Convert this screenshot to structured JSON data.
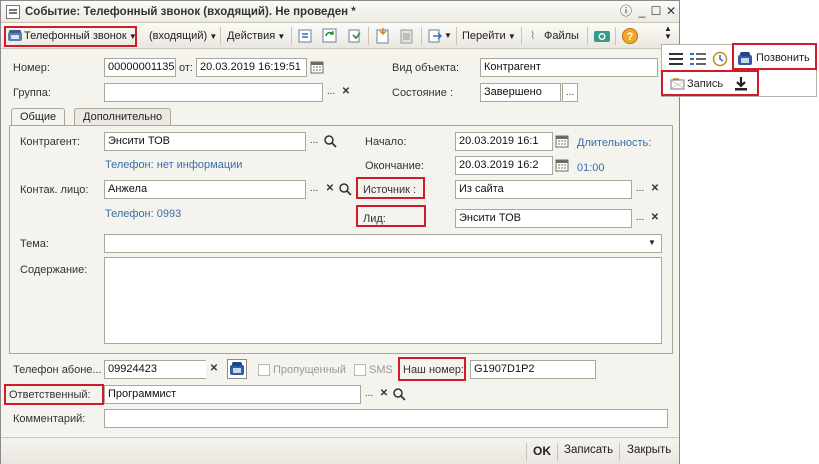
{
  "window": {
    "title": "Событие: Телефонный звонок (входящий). Не проведен *"
  },
  "toolbar": {
    "type_label": "Телефонный звонок",
    "direction_label": "(входящий)",
    "actions_label": "Действия",
    "goto_label": "Перейти",
    "files_label": "Файлы"
  },
  "form": {
    "number_label": "Номер:",
    "number_value": "00000001135",
    "from_label": "от:",
    "date_value": "20.03.2019 16:19:51",
    "object_type_label": "Вид объекта:",
    "object_type_value": "Контрагент",
    "group_label": "Группа:",
    "group_value": "",
    "state_label": "Состояние :",
    "state_value": "Завершено"
  },
  "tabs": [
    {
      "label": "Общие",
      "active": true
    },
    {
      "label": "Дополнительно",
      "active": false
    }
  ],
  "general": {
    "counterparty_label": "Контрагент:",
    "counterparty_value": "Энсити ТОВ",
    "phone_info": "Телефон: нет информации",
    "start_label": "Начало:",
    "start_value": "20.03.2019 16:1",
    "duration_label": "Длительность:",
    "end_label": "Окончание:",
    "end_value": "20.03.2019 16:2",
    "duration_value": "01:00",
    "contact_label": "Контак. лицо:",
    "contact_value": "Анжела",
    "contact_phone": "Телефон: 0993",
    "source_label": "Источник :",
    "source_value": "Из сайта",
    "lead_label": "Лид:",
    "lead_value": "Энсити ТОВ",
    "subject_label": "Тема:",
    "subject_value": "",
    "content_label": "Содержание:",
    "content_value": ""
  },
  "footer_fields": {
    "subscriber_phone_label": "Телефон абоне...",
    "subscriber_phone_value": "09924423",
    "missed_label": "Пропущенный",
    "sms_label": "SMS",
    "our_number_label": "Наш номер:",
    "our_number_value": "G1907D1P2",
    "responsible_label": "Ответственный:",
    "responsible_value": "Программист",
    "comment_label": "Комментарий:",
    "comment_value": ""
  },
  "bottom": {
    "ok_label": "OK",
    "save_label": "Записать",
    "close_label": "Закрыть"
  },
  "popup": {
    "call_label": "Позвонить",
    "record_label": "Запись"
  },
  "colors": {
    "highlight": "#d11b2a",
    "link": "#3a6ea5"
  }
}
